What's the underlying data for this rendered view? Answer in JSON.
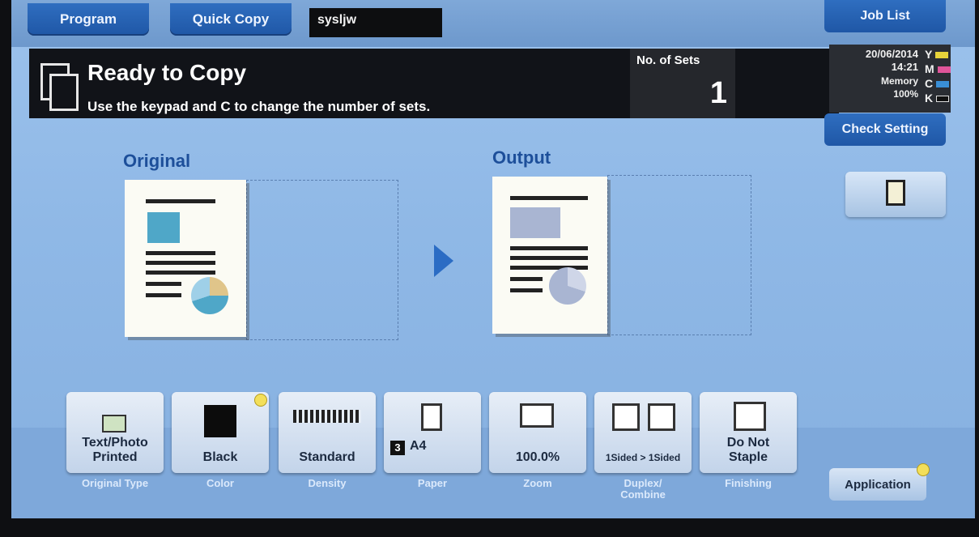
{
  "top_tabs": {
    "program": "Program",
    "quick_copy": "Quick Copy",
    "user": "sysljw",
    "job_list": "Job List"
  },
  "status": {
    "title": "Ready to Copy",
    "message": "Use the keypad and C to change the number of sets."
  },
  "sets": {
    "label": "No. of Sets",
    "value": "1"
  },
  "info": {
    "date": "20/06/2014",
    "time": "14:21",
    "memory_label": "Memory",
    "memory_pct": "100%",
    "toners": [
      {
        "letter": "Y",
        "color": "#e6d23a"
      },
      {
        "letter": "M",
        "color": "#e0559a"
      },
      {
        "letter": "C",
        "color": "#3a8fd6"
      },
      {
        "letter": "K",
        "color": "#111111"
      }
    ]
  },
  "side": {
    "check_setting": "Check Setting"
  },
  "preview": {
    "original_label": "Original",
    "output_label": "Output"
  },
  "functions": {
    "original_type": {
      "value": "Text/Photo\nPrinted",
      "caption": "Original Type"
    },
    "color": {
      "value": "Black",
      "caption": "Color"
    },
    "density": {
      "value": "Standard",
      "caption": "Density"
    },
    "paper": {
      "tray": "3",
      "value": "A4",
      "caption": "Paper"
    },
    "zoom": {
      "value": "100.0%",
      "caption": "Zoom"
    },
    "duplex": {
      "value": "1Sided > 1Sided",
      "caption": "Duplex/\nCombine"
    },
    "finishing": {
      "value": "Do Not\nStaple",
      "caption": "Finishing"
    }
  },
  "application": "Application"
}
